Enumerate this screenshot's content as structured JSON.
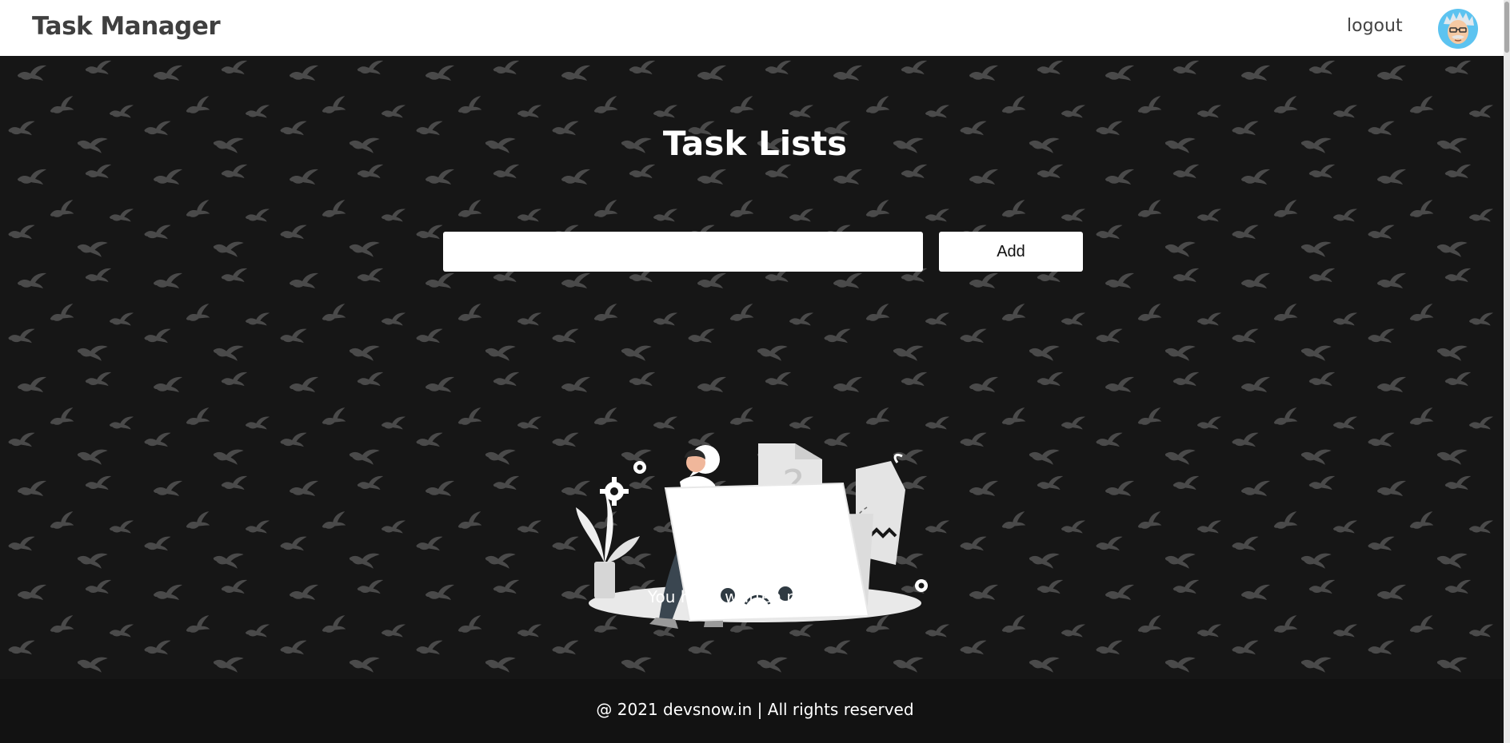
{
  "navbar": {
    "brand": "Task Manager",
    "logout_label": "logout",
    "avatar_icon": "user-avatar-icon",
    "background": "#ffffff"
  },
  "main": {
    "title": "Task Lists",
    "input": {
      "value": "",
      "placeholder": ""
    },
    "add_label": "Add",
    "empty_message": "You have written no notes!",
    "illustration_icon": "empty-state-illustration",
    "background_pattern_icon": "bird-pattern-icon",
    "background": "#161616"
  },
  "footer": {
    "text": "@ 2021 devsnow.in | All rights reserved",
    "background": "#121212"
  }
}
